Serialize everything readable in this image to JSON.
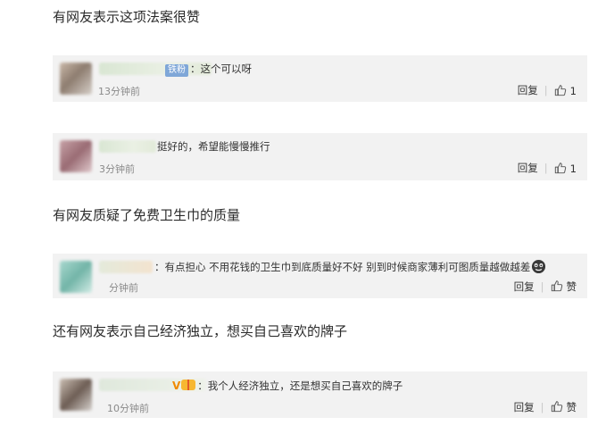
{
  "sections": [
    {
      "title": "有网友表示这项法案很赞",
      "comment": {
        "badge": "铁粉",
        "text": "：这个可以呀",
        "time": "13分钟前",
        "reply": "回复",
        "likes": "1"
      }
    },
    {
      "comment": {
        "text": "挺好的，希望能慢慢推行",
        "time": "3分钟前",
        "reply": "回复",
        "likes": "1"
      }
    },
    {
      "title": "有网友质疑了免费卫生巾的质量",
      "comment": {
        "text": "：有点担心 不用花钱的卫生巾到底质量好不好 别到时候商家薄利可图质量越做越差",
        "time": "分钟前",
        "reply": "回复",
        "like_label": "赞"
      }
    },
    {
      "title": "还有网友表示自己经济独立，想买自己喜欢的牌子",
      "comment": {
        "vip": "V",
        "text": "：我个人经济独立，还是想买自己喜欢的牌子",
        "time": "10分钟前",
        "reply": "回复",
        "like_label": "赞"
      }
    }
  ],
  "icons": {
    "like": "thumbs-up-icon",
    "emoji": "laughing-face-icon"
  }
}
